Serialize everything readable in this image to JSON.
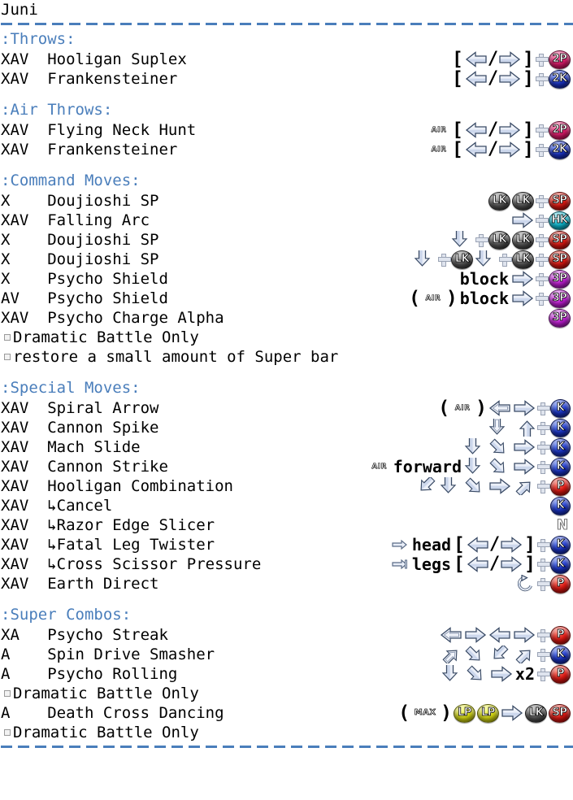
{
  "character": "Juni",
  "colors": {
    "header": "#4a7ebb",
    "text": "#000000",
    "divider": "#4a7ebb",
    "btn_2p": "#e01f6e",
    "btn_2k": "#1b35c8",
    "btn_sp": "#e01a14",
    "btn_hk": "#0fc0d8",
    "btn_3p": "#c21fd6",
    "btn_lk": "#555555",
    "btn_lp": "#d9dd14",
    "btn_k": "#1b35c8",
    "btn_p": "#e01a14"
  },
  "sections": [
    {
      "title": ":Throws:",
      "rows": [
        {
          "modes": "XAV",
          "name": "Hooligan Suplex",
          "seq": [
            {
              "t": "bracket",
              "v": "["
            },
            {
              "t": "arrow",
              "dir": "left"
            },
            {
              "t": "slash",
              "v": "/"
            },
            {
              "t": "arrow",
              "dir": "right"
            },
            {
              "t": "bracket",
              "v": "]"
            },
            {
              "t": "plus"
            },
            {
              "t": "btn",
              "v": "2P",
              "cls": "btn-2p"
            }
          ]
        },
        {
          "modes": "XAV",
          "name": "Frankensteiner",
          "seq": [
            {
              "t": "bracket",
              "v": "["
            },
            {
              "t": "arrow",
              "dir": "left"
            },
            {
              "t": "slash",
              "v": "/"
            },
            {
              "t": "arrow",
              "dir": "right"
            },
            {
              "t": "bracket",
              "v": "]"
            },
            {
              "t": "plus"
            },
            {
              "t": "btn",
              "v": "2K",
              "cls": "btn-2k"
            }
          ]
        }
      ],
      "notes": []
    },
    {
      "title": ":Air Throws:",
      "rows": [
        {
          "modes": "XAV",
          "name": "Flying Neck Hunt",
          "seq": [
            {
              "t": "air",
              "v": "AIR"
            },
            {
              "t": "bracket",
              "v": "["
            },
            {
              "t": "arrow",
              "dir": "left"
            },
            {
              "t": "slash",
              "v": "/"
            },
            {
              "t": "arrow",
              "dir": "right"
            },
            {
              "t": "bracket",
              "v": "]"
            },
            {
              "t": "plus"
            },
            {
              "t": "btn",
              "v": "2P",
              "cls": "btn-2p"
            }
          ]
        },
        {
          "modes": "XAV",
          "name": "Frankensteiner",
          "seq": [
            {
              "t": "air",
              "v": "AIR"
            },
            {
              "t": "bracket",
              "v": "["
            },
            {
              "t": "arrow",
              "dir": "left"
            },
            {
              "t": "slash",
              "v": "/"
            },
            {
              "t": "arrow",
              "dir": "right"
            },
            {
              "t": "bracket",
              "v": "]"
            },
            {
              "t": "plus"
            },
            {
              "t": "btn",
              "v": "2K",
              "cls": "btn-2k"
            }
          ]
        }
      ],
      "notes": []
    },
    {
      "title": ":Command Moves:",
      "rows": [
        {
          "modes": "X",
          "name": "Doujioshi SP",
          "seq": [
            {
              "t": "btn",
              "v": "LK",
              "cls": "btn-lk"
            },
            {
              "t": "btn",
              "v": "LK",
              "cls": "btn-lk"
            },
            {
              "t": "plus"
            },
            {
              "t": "btn",
              "v": "SP",
              "cls": "btn-sp"
            }
          ]
        },
        {
          "modes": "XAV",
          "name": "Falling Arc",
          "seq": [
            {
              "t": "arrow",
              "dir": "right"
            },
            {
              "t": "plus"
            },
            {
              "t": "btn",
              "v": "HK",
              "cls": "btn-hk"
            }
          ]
        },
        {
          "modes": "X",
          "name": "Doujioshi SP",
          "seq": [
            {
              "t": "arrow",
              "dir": "down"
            },
            {
              "t": "plus"
            },
            {
              "t": "btn",
              "v": "LK",
              "cls": "btn-lk"
            },
            {
              "t": "btn",
              "v": "LK",
              "cls": "btn-lk"
            },
            {
              "t": "plus"
            },
            {
              "t": "btn",
              "v": "SP",
              "cls": "btn-sp"
            }
          ]
        },
        {
          "modes": "X",
          "name": "Doujioshi SP",
          "seq": [
            {
              "t": "arrow",
              "dir": "down"
            },
            {
              "t": "plus"
            },
            {
              "t": "btn",
              "v": "LK",
              "cls": "btn-lk"
            },
            {
              "t": "arrow",
              "dir": "down"
            },
            {
              "t": "plus"
            },
            {
              "t": "btn",
              "v": "LK",
              "cls": "btn-lk"
            },
            {
              "t": "plus"
            },
            {
              "t": "btn",
              "v": "SP",
              "cls": "btn-sp"
            }
          ]
        },
        {
          "modes": "X",
          "name": "Psycho Shield",
          "seq": [
            {
              "t": "lit",
              "v": "block"
            },
            {
              "t": "arrow",
              "dir": "right"
            },
            {
              "t": "plus"
            },
            {
              "t": "btn",
              "v": "3P",
              "cls": "btn-3p"
            }
          ]
        },
        {
          "modes": "AV",
          "name": "Psycho Shield",
          "seq": [
            {
              "t": "paren",
              "v": "("
            },
            {
              "t": "air",
              "v": "AIR"
            },
            {
              "t": "paren",
              "v": ")"
            },
            {
              "t": "lit",
              "v": "block"
            },
            {
              "t": "arrow",
              "dir": "right"
            },
            {
              "t": "plus"
            },
            {
              "t": "btn",
              "v": "3P",
              "cls": "btn-3p"
            }
          ]
        },
        {
          "modes": "XAV",
          "name": "Psycho Charge Alpha",
          "seq": [
            {
              "t": "btn",
              "v": "3P",
              "cls": "btn-3p"
            }
          ]
        }
      ],
      "notes": [
        "Dramatic Battle Only",
        "restore a small amount of Super bar"
      ]
    },
    {
      "title": ":Special Moves:",
      "rows": [
        {
          "modes": "XAV",
          "name": "Spiral Arrow",
          "seq": [
            {
              "t": "paren",
              "v": "("
            },
            {
              "t": "air",
              "v": "AIR"
            },
            {
              "t": "paren",
              "v": ")"
            },
            {
              "t": "arrow",
              "dir": "chargeleft"
            },
            {
              "t": "arrow",
              "dir": "right"
            },
            {
              "t": "plus"
            },
            {
              "t": "btn",
              "v": "K",
              "cls": "btn-k"
            }
          ]
        },
        {
          "modes": "XAV",
          "name": "Cannon Spike",
          "seq": [
            {
              "t": "arrow",
              "dir": "chargedown"
            },
            {
              "t": "arrow",
              "dir": "up"
            },
            {
              "t": "plus"
            },
            {
              "t": "btn",
              "v": "K",
              "cls": "btn-k"
            }
          ]
        },
        {
          "modes": "XAV",
          "name": "Mach Slide",
          "seq": [
            {
              "t": "arrow",
              "dir": "down"
            },
            {
              "t": "arrow",
              "dir": "downright"
            },
            {
              "t": "arrow",
              "dir": "right"
            },
            {
              "t": "plus"
            },
            {
              "t": "btn",
              "v": "K",
              "cls": "btn-k"
            }
          ]
        },
        {
          "modes": "XAV",
          "name": "Cannon Strike",
          "seq": [
            {
              "t": "air",
              "v": "AIR"
            },
            {
              "t": "lit",
              "v": "forward"
            },
            {
              "t": "arrow",
              "dir": "down"
            },
            {
              "t": "arrow",
              "dir": "downright"
            },
            {
              "t": "arrow",
              "dir": "right"
            },
            {
              "t": "plus"
            },
            {
              "t": "btn",
              "v": "K",
              "cls": "btn-k"
            }
          ]
        },
        {
          "modes": "XAV",
          "name": "Hooligan Combination",
          "seq": [
            {
              "t": "arrow",
              "dir": "downleft"
            },
            {
              "t": "arrow",
              "dir": "down"
            },
            {
              "t": "arrow",
              "dir": "downright"
            },
            {
              "t": "arrow",
              "dir": "right"
            },
            {
              "t": "arrow",
              "dir": "upright"
            },
            {
              "t": "plus"
            },
            {
              "t": "btn",
              "v": "P",
              "cls": "btn-p"
            }
          ]
        },
        {
          "modes": "XAV",
          "name": "↳Cancel",
          "seq": [
            {
              "t": "btn",
              "v": "K",
              "cls": "btn-k"
            }
          ]
        },
        {
          "modes": "XAV",
          "name": "↳Razor Edge Slicer",
          "seq": [
            {
              "t": "ntag",
              "v": "N"
            }
          ]
        },
        {
          "modes": "XAV",
          "name": "↳Fatal Leg Twister",
          "seq": [
            {
              "t": "thin",
              "dir": "right"
            },
            {
              "t": "lit",
              "v": "head"
            },
            {
              "t": "bracket",
              "v": "["
            },
            {
              "t": "arrow",
              "dir": "left"
            },
            {
              "t": "slash",
              "v": "/"
            },
            {
              "t": "arrow",
              "dir": "right"
            },
            {
              "t": "bracket",
              "v": "]"
            },
            {
              "t": "plus"
            },
            {
              "t": "btn",
              "v": "K",
              "cls": "btn-k"
            }
          ]
        },
        {
          "modes": "XAV",
          "name": "↳Cross Scissor Pressure",
          "seq": [
            {
              "t": "thin",
              "dir": "rightbar"
            },
            {
              "t": "lit",
              "v": "legs"
            },
            {
              "t": "bracket",
              "v": "["
            },
            {
              "t": "arrow",
              "dir": "left"
            },
            {
              "t": "slash",
              "v": "/"
            },
            {
              "t": "arrow",
              "dir": "right"
            },
            {
              "t": "bracket",
              "v": "]"
            },
            {
              "t": "plus"
            },
            {
              "t": "btn",
              "v": "K",
              "cls": "btn-k"
            }
          ]
        },
        {
          "modes": "XAV",
          "name": "Earth Direct",
          "seq": [
            {
              "t": "rot"
            },
            {
              "t": "plus"
            },
            {
              "t": "btn",
              "v": "P",
              "cls": "btn-p"
            }
          ]
        }
      ],
      "notes": []
    },
    {
      "title": ":Super Combos:",
      "rows": [
        {
          "modes": "XA",
          "name": "Psycho Streak",
          "seq": [
            {
              "t": "arrow",
              "dir": "chargeleft"
            },
            {
              "t": "arrow",
              "dir": "right"
            },
            {
              "t": "arrow",
              "dir": "left"
            },
            {
              "t": "arrow",
              "dir": "right"
            },
            {
              "t": "plus"
            },
            {
              "t": "btn",
              "v": "P",
              "cls": "btn-p"
            }
          ]
        },
        {
          "modes": "A",
          "name": "Spin Drive Smasher",
          "seq": [
            {
              "t": "arrow",
              "dir": "chargeupright"
            },
            {
              "t": "arrow",
              "dir": "downright"
            },
            {
              "t": "arrow",
              "dir": "downleft"
            },
            {
              "t": "arrow",
              "dir": "upright"
            },
            {
              "t": "plus"
            },
            {
              "t": "btn",
              "v": "K",
              "cls": "btn-k"
            }
          ]
        },
        {
          "modes": "A",
          "name": "Psycho Rolling",
          "seq": [
            {
              "t": "arrow",
              "dir": "down"
            },
            {
              "t": "arrow",
              "dir": "downright"
            },
            {
              "t": "arrow",
              "dir": "right"
            },
            {
              "t": "lit",
              "v": "x2"
            },
            {
              "t": "plus"
            },
            {
              "t": "btn",
              "v": "P",
              "cls": "btn-p"
            }
          ]
        }
      ],
      "notes": [
        "Dramatic Battle Only"
      ],
      "extra_rows": [
        {
          "modes": "A",
          "name": "Death Cross Dancing",
          "seq": [
            {
              "t": "paren",
              "v": "("
            },
            {
              "t": "max",
              "v": "MAX"
            },
            {
              "t": "paren",
              "v": ")"
            },
            {
              "t": "btn",
              "v": "LP",
              "cls": "btn-lp"
            },
            {
              "t": "btn",
              "v": "LP",
              "cls": "btn-lp"
            },
            {
              "t": "arrow",
              "dir": "right"
            },
            {
              "t": "btn",
              "v": "LK",
              "cls": "btn-lk"
            },
            {
              "t": "btn",
              "v": "SP",
              "cls": "btn-sp"
            }
          ]
        }
      ],
      "extra_notes": [
        "Dramatic Battle Only"
      ]
    }
  ]
}
